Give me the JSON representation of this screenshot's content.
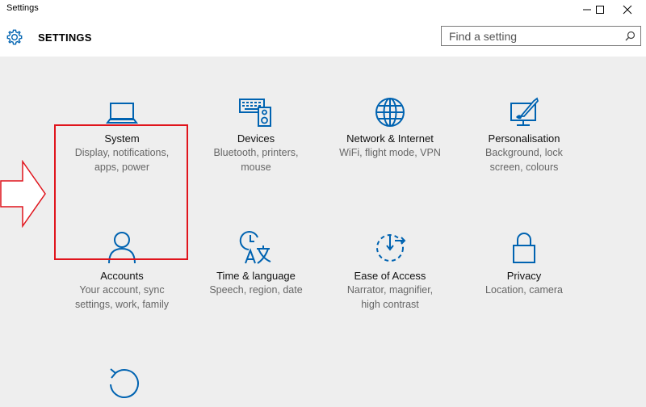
{
  "window": {
    "title": "Settings",
    "minimize_icon": "minimize-icon",
    "maximize_icon": "maximize-icon",
    "close_icon": "close-icon"
  },
  "header": {
    "title": "SETTINGS",
    "icon": "gear-icon",
    "search_placeholder": "Find a setting",
    "search_icon": "search-icon"
  },
  "colors": {
    "accent": "#0063b1",
    "highlight_border": "#e0141c",
    "content_bg": "#eeeeee"
  },
  "tiles": [
    {
      "name": "System",
      "desc_line1": "Display, notifications,",
      "desc_line2": "apps, power",
      "icon": "laptop-icon"
    },
    {
      "name": "Devices",
      "desc_line1": "Bluetooth, printers,",
      "desc_line2": "mouse",
      "icon": "devices-icon"
    },
    {
      "name": "Network & Internet",
      "desc_line1": "WiFi, flight mode, VPN",
      "desc_line2": "",
      "icon": "globe-icon"
    },
    {
      "name": "Personalisation",
      "desc_line1": "Background, lock",
      "desc_line2": "screen, colours",
      "icon": "personalisation-icon"
    },
    {
      "name": "Accounts",
      "desc_line1": "Your account, sync",
      "desc_line2": "settings, work, family",
      "icon": "person-icon"
    },
    {
      "name": "Time & language",
      "desc_line1": "Speech, region, date",
      "desc_line2": "",
      "icon": "time-language-icon"
    },
    {
      "name": "Ease of Access",
      "desc_line1": "Narrator, magnifier,",
      "desc_line2": "high contrast",
      "icon": "ease-of-access-icon"
    },
    {
      "name": "Privacy",
      "desc_line1": "Location, camera",
      "desc_line2": "",
      "icon": "lock-icon"
    },
    {
      "name": "",
      "desc_line1": "",
      "desc_line2": "",
      "icon": "update-icon"
    }
  ],
  "annotation": {
    "arrow_icon": "red-arrow-icon",
    "highlight": "system-highlight-box"
  }
}
